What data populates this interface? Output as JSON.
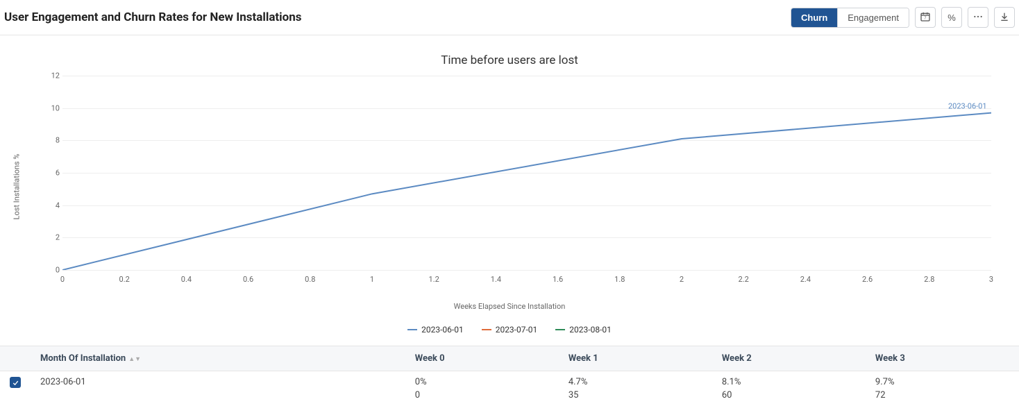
{
  "header": {
    "title": "User Engagement and Churn Rates for New Installations",
    "seg_churn": "Churn",
    "seg_engagement": "Engagement",
    "percent_label": "%"
  },
  "chart_data": {
    "type": "line",
    "title": "Time before users are lost",
    "xlabel": "Weeks Elapsed Since Installation",
    "ylabel": "Lost Installations %",
    "xlim": [
      0,
      3
    ],
    "ylim": [
      0,
      12
    ],
    "x_ticks": [
      0,
      0.2,
      0.4,
      0.6,
      0.8,
      1,
      1.2,
      1.4,
      1.6,
      1.8,
      2,
      2.2,
      2.4,
      2.6,
      2.8,
      3
    ],
    "y_ticks": [
      0,
      2,
      4,
      6,
      8,
      10,
      12
    ],
    "series": [
      {
        "name": "2023-06-01",
        "color": "#5b8ac2",
        "x": [
          0,
          1,
          2,
          3
        ],
        "y": [
          0,
          4.7,
          8.1,
          9.7
        ]
      },
      {
        "name": "2023-07-01",
        "color": "#e06c3a",
        "x": [],
        "y": []
      },
      {
        "name": "2023-08-01",
        "color": "#2e8b57",
        "x": [],
        "y": []
      }
    ],
    "end_label": "2023-06-01"
  },
  "table": {
    "headers": [
      "Month Of Installation",
      "Week 0",
      "Week 1",
      "Week 2",
      "Week 3"
    ],
    "row": {
      "month": "2023-06-01",
      "cells": [
        {
          "pct": "0%",
          "count": "0"
        },
        {
          "pct": "4.7%",
          "count": "35"
        },
        {
          "pct": "8.1%",
          "count": "60"
        },
        {
          "pct": "9.7%",
          "count": "72"
        }
      ]
    }
  }
}
